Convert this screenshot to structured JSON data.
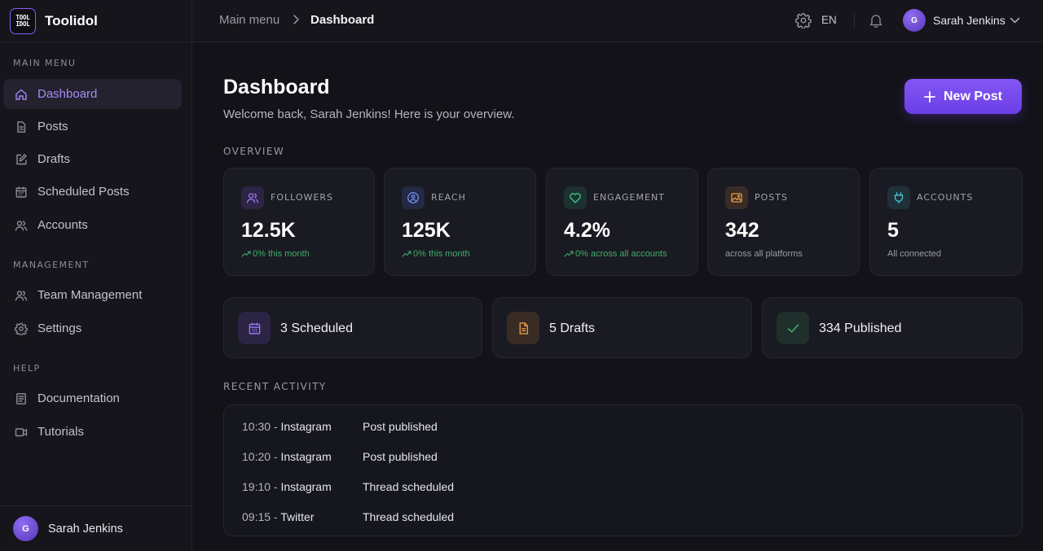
{
  "brand": {
    "logo_line1": "TOOL",
    "logo_line2": "IDOL",
    "name": "Toolidol"
  },
  "sidebar": {
    "sections": [
      {
        "label": "MAIN MENU"
      },
      {
        "label": "MANAGEMENT"
      },
      {
        "label": "HELP"
      }
    ],
    "items": [
      {
        "label": "Dashboard",
        "icon": "home-icon",
        "active": true
      },
      {
        "label": "Posts",
        "icon": "document-icon"
      },
      {
        "label": "Drafts",
        "icon": "edit-icon"
      },
      {
        "label": "Scheduled Posts",
        "icon": "calendar-icon"
      },
      {
        "label": "Accounts",
        "icon": "users-icon"
      },
      {
        "label": "Team Management",
        "icon": "team-icon"
      },
      {
        "label": "Settings",
        "icon": "gear-icon"
      },
      {
        "label": "Documentation",
        "icon": "book-icon"
      },
      {
        "label": "Tutorials",
        "icon": "video-icon"
      }
    ],
    "footer": {
      "avatar_initial": "G",
      "name": "Sarah Jenkins"
    }
  },
  "topbar": {
    "breadcrumb": {
      "parent": "Main menu",
      "current": "Dashboard"
    },
    "language": "EN",
    "user": {
      "avatar_initial": "G",
      "name": "Sarah Jenkins"
    }
  },
  "header": {
    "title": "Dashboard",
    "subtitle": "Welcome back, Sarah Jenkins! Here is your overview.",
    "new_post_label": "New Post"
  },
  "overview": {
    "label": "OVERVIEW",
    "cards": [
      {
        "label": "FOLLOWERS",
        "value": "12.5K",
        "sub": "0% this month",
        "trend": true,
        "icon": "followers-icon",
        "color": "#8b5cf6"
      },
      {
        "label": "REACH",
        "value": "125K",
        "sub": "0% this month",
        "trend": true,
        "icon": "reach-icon",
        "color": "#5b7cf6"
      },
      {
        "label": "ENGAGEMENT",
        "value": "4.2%",
        "sub": "0% across all accounts",
        "trend": true,
        "icon": "heart-icon",
        "color": "#34c48a"
      },
      {
        "label": "POSTS",
        "value": "342",
        "sub": "across all platforms",
        "trend": false,
        "icon": "image-icon",
        "color": "#e0913a"
      },
      {
        "label": "ACCOUNTS",
        "value": "5",
        "sub": "All connected",
        "trend": false,
        "icon": "plug-icon",
        "color": "#3fb8c8"
      }
    ]
  },
  "summary": [
    {
      "text": "3 Scheduled",
      "icon": "calendar-icon",
      "color": "#8b5cf6"
    },
    {
      "text": "5 Drafts",
      "icon": "document-icon",
      "color": "#e0913a"
    },
    {
      "text": "334 Published",
      "icon": "check-icon",
      "color": "#3fae6a"
    }
  ],
  "activity": {
    "label": "RECENT ACTIVITY",
    "rows": [
      {
        "time": "10:30",
        "platform": "Instagram",
        "event": "Post published"
      },
      {
        "time": "10:20",
        "platform": "Instagram",
        "event": "Post published"
      },
      {
        "time": "19:10",
        "platform": "Instagram",
        "event": "Thread scheduled"
      },
      {
        "time": "09:15",
        "platform": "Twitter",
        "event": "Thread scheduled"
      }
    ]
  }
}
